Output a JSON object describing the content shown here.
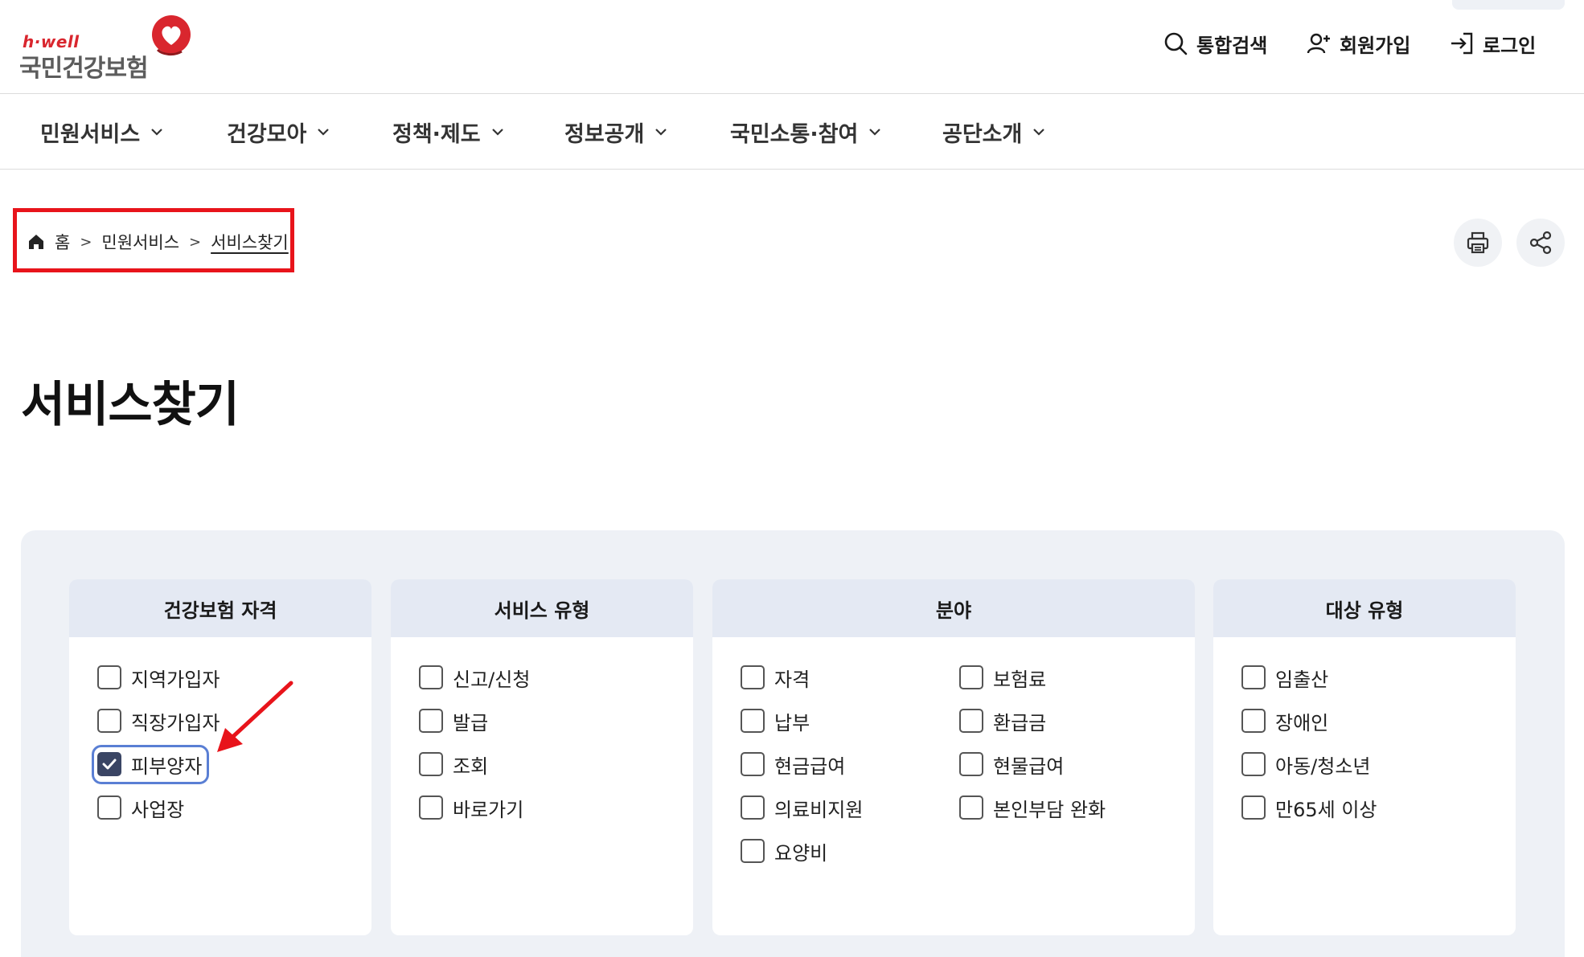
{
  "header": {
    "logo_sub": "h·well",
    "logo_main": "국민건강보험",
    "utilities": [
      {
        "label": "통합검색",
        "icon": "search-icon"
      },
      {
        "label": "회원가입",
        "icon": "user-add-icon"
      },
      {
        "label": "로그인",
        "icon": "login-icon"
      }
    ]
  },
  "gnb": {
    "items": [
      "민원서비스",
      "건강모아",
      "정책·제도",
      "정보공개",
      "국민소통·참여",
      "공단소개"
    ]
  },
  "breadcrumb": {
    "home": "홈",
    "level1": "민원서비스",
    "current": "서비스찾기"
  },
  "page": {
    "title": "서비스찾기"
  },
  "filters": {
    "qualification": {
      "title": "건강보험 자격",
      "options": [
        {
          "label": "지역가입자",
          "checked": false
        },
        {
          "label": "직장가입자",
          "checked": false
        },
        {
          "label": "피부양자",
          "checked": true
        },
        {
          "label": "사업장",
          "checked": false
        }
      ]
    },
    "service_type": {
      "title": "서비스 유형",
      "options": [
        {
          "label": "신고/신청",
          "checked": false
        },
        {
          "label": "발급",
          "checked": false
        },
        {
          "label": "조회",
          "checked": false
        },
        {
          "label": "바로가기",
          "checked": false
        }
      ]
    },
    "field": {
      "title": "분야",
      "options": [
        {
          "label": "자격",
          "checked": false
        },
        {
          "label": "보험료",
          "checked": false
        },
        {
          "label": "납부",
          "checked": false
        },
        {
          "label": "환급금",
          "checked": false
        },
        {
          "label": "현금급여",
          "checked": false
        },
        {
          "label": "현물급여",
          "checked": false
        },
        {
          "label": "의료비지원",
          "checked": false
        },
        {
          "label": "본인부담 완화",
          "checked": false
        },
        {
          "label": "요양비",
          "checked": false
        }
      ]
    },
    "target_type": {
      "title": "대상 유형",
      "options": [
        {
          "label": "임출산",
          "checked": false
        },
        {
          "label": "장애인",
          "checked": false
        },
        {
          "label": "아동/청소년",
          "checked": false
        },
        {
          "label": "만65세 이상",
          "checked": false
        }
      ]
    }
  },
  "colors": {
    "brand_red": "#d9262e",
    "highlight_red": "#e8141b",
    "checkbox_checked": "#3a4564",
    "focus_ring": "#5a7fd4",
    "panel_bg": "#eef1f6",
    "card_head_bg": "#e4e9f3"
  }
}
